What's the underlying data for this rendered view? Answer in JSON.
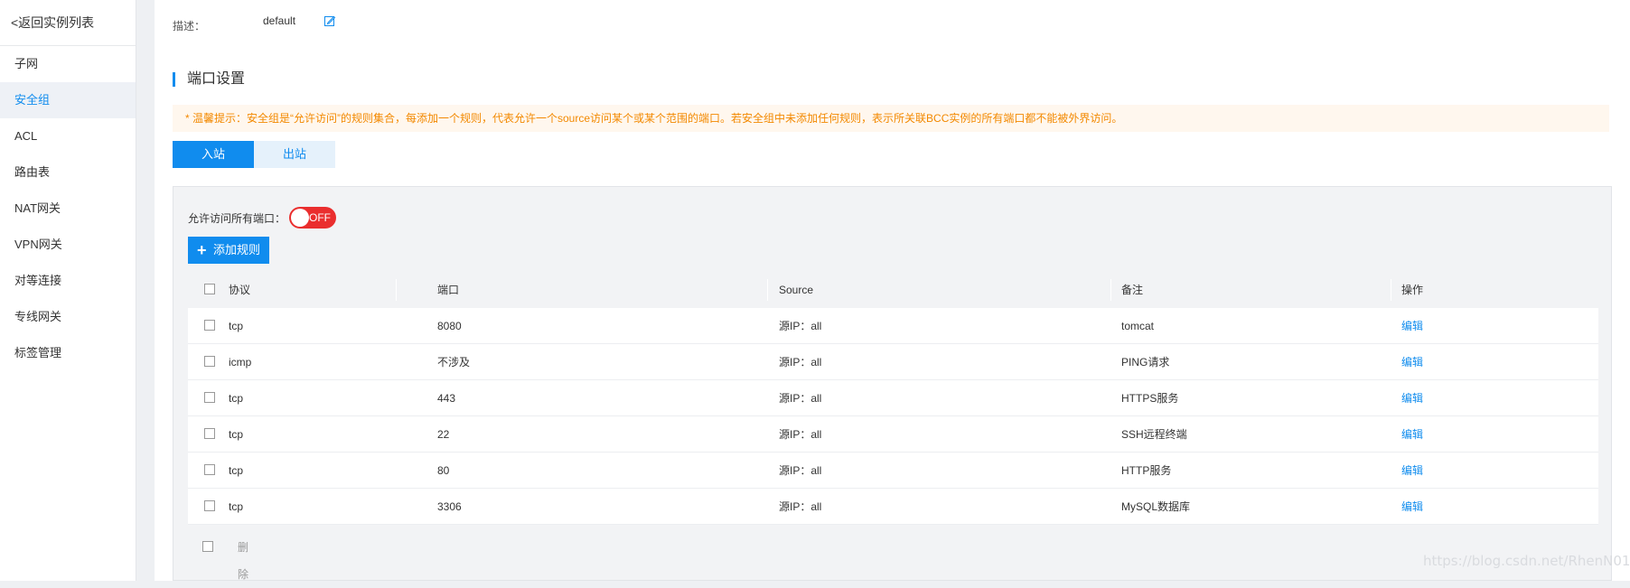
{
  "sidebar": {
    "back": "<返回实例列表",
    "items": [
      {
        "label": "子网"
      },
      {
        "label": "安全组"
      },
      {
        "label": "ACL"
      },
      {
        "label": "路由表"
      },
      {
        "label": "NAT网关"
      },
      {
        "label": "VPN网关"
      },
      {
        "label": "对等连接"
      },
      {
        "label": "专线网关"
      },
      {
        "label": "标签管理"
      }
    ]
  },
  "description": {
    "label": "描述：",
    "value": "default"
  },
  "section": {
    "title": "端口设置"
  },
  "tip": "* 温馨提示：安全组是“允许访问”的规则集合，每添加一个规则，代表允许一个source访问某个或某个范围的端口。若安全组中未添加任何规则，表示所关联BCC实例的所有端口都不能被外界访问。",
  "tabs": [
    {
      "label": "入站"
    },
    {
      "label": "出站"
    }
  ],
  "allow_all": {
    "label": "允许访问所有端口：",
    "toggle": "OFF"
  },
  "add_rule": {
    "label": "添加规则"
  },
  "table": {
    "headers": {
      "protocol": "协议",
      "port": "端口",
      "source": "Source",
      "note": "备注",
      "op": "操作"
    },
    "rows": [
      {
        "protocol": "tcp",
        "port": "8080",
        "source": "源IP：all",
        "note": "tomcat",
        "op": "编辑"
      },
      {
        "protocol": "icmp",
        "port": "不涉及",
        "source": "源IP：all",
        "note": "PING请求",
        "op": "编辑"
      },
      {
        "protocol": "tcp",
        "port": "443",
        "source": "源IP：all",
        "note": "HTTPS服务",
        "op": "编辑"
      },
      {
        "protocol": "tcp",
        "port": "22",
        "source": "源IP：all",
        "note": "SSH远程终端",
        "op": "编辑"
      },
      {
        "protocol": "tcp",
        "port": "80",
        "source": "源IP：all",
        "note": "HTTP服务",
        "op": "编辑"
      },
      {
        "protocol": "tcp",
        "port": "3306",
        "source": "源IP：all",
        "note": "MySQL数据库",
        "op": "编辑"
      }
    ]
  },
  "footer": {
    "delete": "删除"
  },
  "watermark": "https://blog.csdn.net/RhenN01",
  "colors": {
    "accent": "#108cee",
    "toggle_off": "#ea2e2e",
    "tip": "#f38900"
  }
}
